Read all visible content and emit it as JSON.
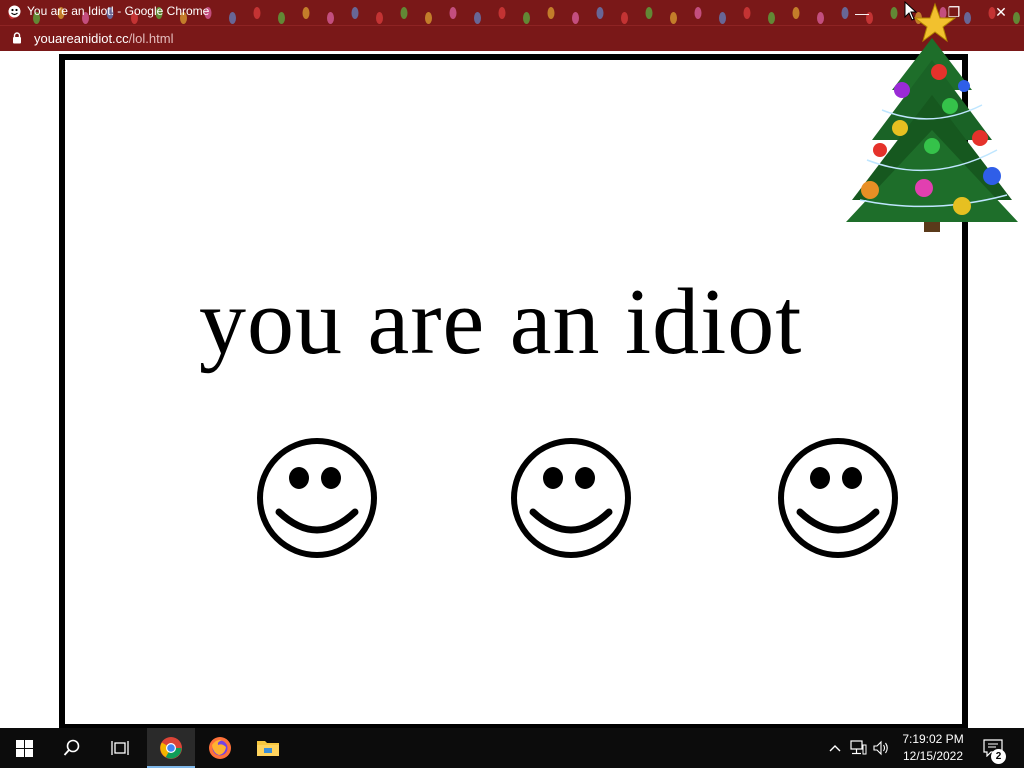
{
  "window": {
    "title": "You are an Idiot! - Google Chrome",
    "controls": {
      "minimize": "—",
      "restore": "❐",
      "close": "✕"
    }
  },
  "address_bar": {
    "url_host": "youareanidiot.cc",
    "url_path": "/lol.html",
    "icon": "lock-icon"
  },
  "page": {
    "headline": "you are an idiot",
    "smileys": [
      "smiley-face-icon",
      "smiley-face-icon",
      "smiley-face-icon"
    ],
    "decoration": "christmas-tree"
  },
  "taskbar": {
    "apps": [
      "windows-start",
      "search",
      "task-view",
      "google-chrome",
      "firefox",
      "file-explorer"
    ],
    "active_app": "google-chrome",
    "tray_icons": [
      "chevron-up-icon",
      "network-icon",
      "volume-icon"
    ],
    "clock": {
      "time": "7:19:02 PM",
      "date": "12/15/2022"
    },
    "notifications": {
      "count": "2"
    }
  },
  "colors": {
    "titlebar": "#7a1818",
    "page_background": "#ffffff",
    "frame_border": "#000000",
    "taskbar": "#0c0c0c",
    "light_colors": [
      "#ff4a4a",
      "#4ee64e",
      "#ffd23a",
      "#ff7bd3",
      "#59a8ff"
    ]
  }
}
